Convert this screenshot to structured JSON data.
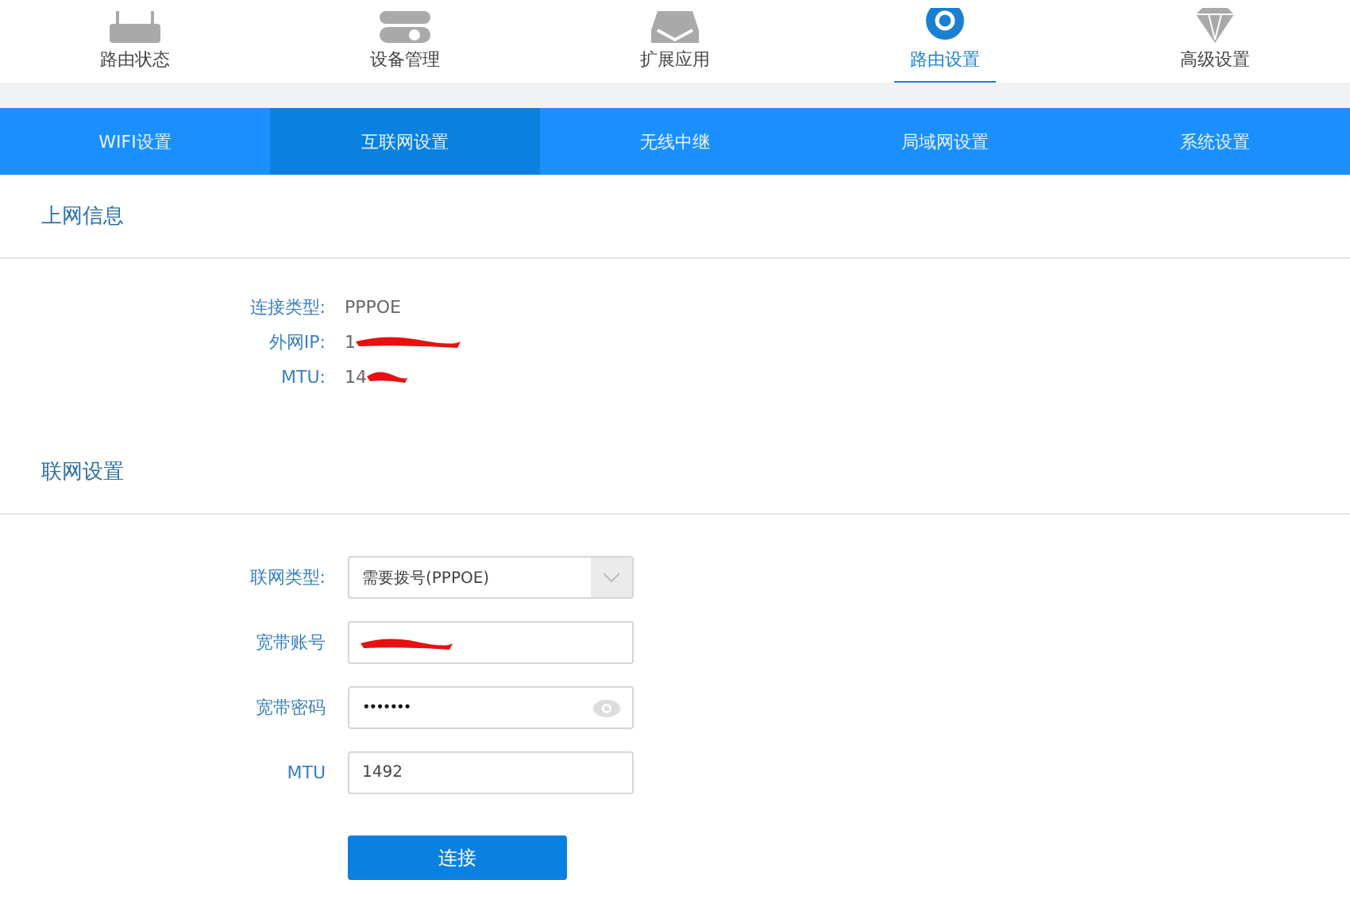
{
  "top_nav": [
    {
      "kind": "router",
      "label": "路由状态",
      "selected": false
    },
    {
      "kind": "toggle",
      "label": "设备管理",
      "selected": false
    },
    {
      "kind": "tray",
      "label": "扩展应用",
      "selected": false
    },
    {
      "kind": "gear",
      "label": "路由设置",
      "selected": true
    },
    {
      "kind": "diamond",
      "label": "高级设置",
      "selected": false
    }
  ],
  "sub_tabs": [
    {
      "label": "WIFI设置",
      "selected": false
    },
    {
      "label": "互联网设置",
      "selected": true
    },
    {
      "label": "无线中继",
      "selected": false
    },
    {
      "label": "局域网设置",
      "selected": false
    },
    {
      "label": "系统设置",
      "selected": false
    }
  ],
  "internet_info": {
    "title": "上网信息",
    "rows": [
      {
        "label": "连接类型:",
        "value": "PPPOE",
        "redacted": false
      },
      {
        "label": "外网IP:",
        "value": "1",
        "redacted": true
      },
      {
        "label": "MTU:",
        "value": "14",
        "redacted": true
      }
    ]
  },
  "network_settings": {
    "title": "联网设置",
    "fields": [
      {
        "kind": "select",
        "label": "联网类型:",
        "value": "需要拨号(PPPOE)",
        "redacted": false
      },
      {
        "kind": "text",
        "label": "宽带账号",
        "redacted": true
      },
      {
        "kind": "password",
        "label": "宽带密码",
        "value": "•••••••",
        "redacted": false
      },
      {
        "kind": "text",
        "label": "MTU",
        "value": "1492",
        "redacted": false
      }
    ],
    "submit": "连接"
  }
}
